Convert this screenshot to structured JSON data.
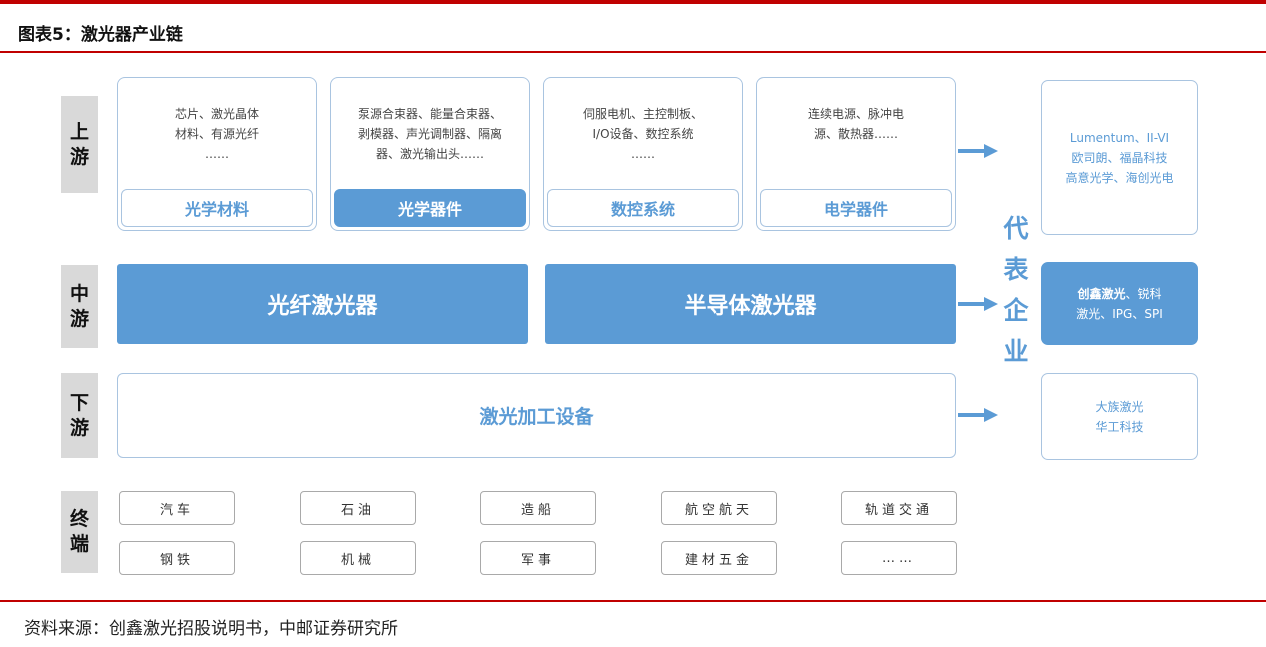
{
  "figure_title": "图表5：激光器产业链",
  "source": "资料来源：创鑫激光招股说明书，中邮证券研究所",
  "row_labels": {
    "upstream": [
      "上",
      "游"
    ],
    "midstream": [
      "中",
      "游"
    ],
    "downstream": [
      "下",
      "游"
    ],
    "terminal": [
      "终",
      "端"
    ]
  },
  "upstream_cards": [
    {
      "lines": [
        "芯片、激光晶体",
        "材料、有源光纤",
        "……"
      ],
      "label": "光学材料"
    },
    {
      "lines": [
        "泵源合束器、能量合束器、",
        "剥模器、声光调制器、隔离",
        "器、激光输出头……"
      ],
      "label": "光学器件"
    },
    {
      "lines": [
        "伺服电机、主控制板、",
        "I/O设备、数控系统",
        "……"
      ],
      "label": "数控系统"
    },
    {
      "lines": [
        "连续电源、脉冲电",
        "源、散热器……"
      ],
      "label": "电学器件"
    }
  ],
  "midstream": [
    "光纤激光器",
    "半导体激光器"
  ],
  "downstream": "激光加工设备",
  "rep_label": [
    "代",
    "表",
    "企",
    "业"
  ],
  "enterprises": {
    "upstream": [
      "Lumentum、II-VI",
      "欧司朗、福晶科技",
      "高意光学、海创光电"
    ],
    "midstream_bold": "创鑫激光",
    "midstream_rest_1": "、锐科",
    "midstream_line2": "激光、IPG、SPI",
    "downstream": [
      "大族激光",
      "华工科技"
    ]
  },
  "terminals": [
    [
      "汽车",
      "钢铁"
    ],
    [
      "石油",
      "机械"
    ],
    [
      "造船",
      "军事"
    ],
    [
      "航空航天",
      "建材五金"
    ],
    [
      "轨道交通",
      "……"
    ]
  ],
  "colors": {
    "accent": "#5b9bd5",
    "rule": "#c00000",
    "label_bg": "#d9d9d9"
  }
}
